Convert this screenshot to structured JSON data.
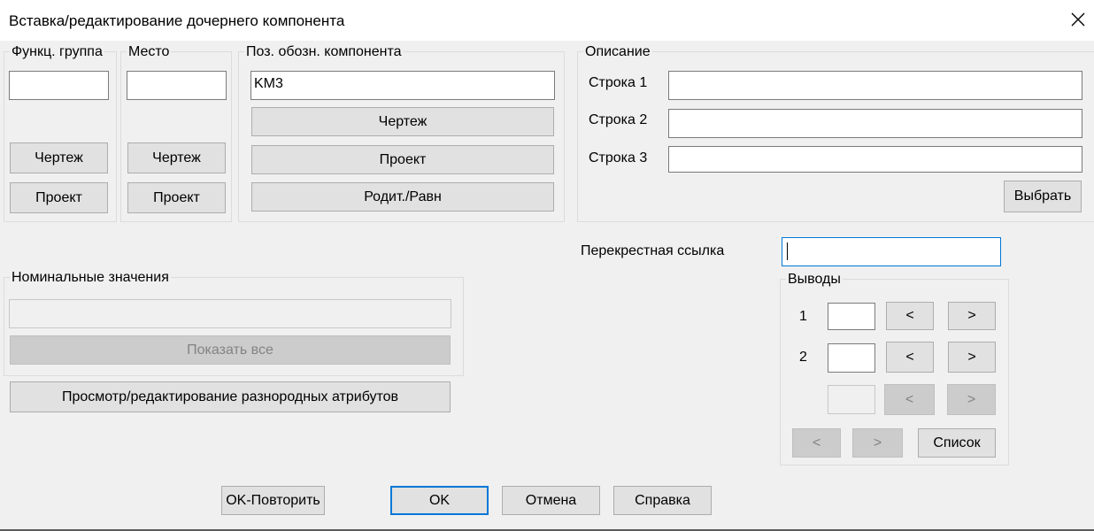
{
  "window": {
    "title": "Вставка/редактирование дочернего компонента",
    "close_icon": "close-icon"
  },
  "func_group": {
    "label": "Функц. группа",
    "value": "",
    "drawing_label": "Чертеж",
    "project_label": "Проект"
  },
  "location": {
    "label": "Место",
    "value": "",
    "drawing_label": "Чертеж",
    "project_label": "Проект"
  },
  "component_tag": {
    "label": "Поз. обозн. компонента",
    "value": "KM3",
    "drawing_label": "Чертеж",
    "project_label": "Проект",
    "parent_sibling_label": "Родит./Равн"
  },
  "description": {
    "label": "Описание",
    "line1_label": "Строка 1",
    "line1_value": "",
    "line2_label": "Строка 2",
    "line2_value": "",
    "line3_label": "Строка 3",
    "line3_value": "",
    "pick_label": "Выбрать"
  },
  "cross_reference": {
    "label": "Перекрестная ссылка",
    "value": ""
  },
  "ratings": {
    "label": "Номинальные значения",
    "value": "",
    "show_all_label": "Показать все"
  },
  "attributes_button_label": "Просмотр/редактирование разнородных атрибутов",
  "pins": {
    "label": "Выводы",
    "pin1_label": "1",
    "pin1_value": "",
    "pin2_label": "2",
    "pin2_value": "",
    "pin3_value": "",
    "prev_label": "<",
    "next_label": ">",
    "list_label": "Список"
  },
  "footer": {
    "ok_repeat_label": "OK-Повторить",
    "ok_label": "OK",
    "cancel_label": "Отмена",
    "help_label": "Справка"
  },
  "colors": {
    "dialog_bg": "#f0f0f0",
    "titlebar_bg": "#ffffff",
    "button_bg": "#e1e1e1",
    "focus_accent": "#0078d7"
  }
}
